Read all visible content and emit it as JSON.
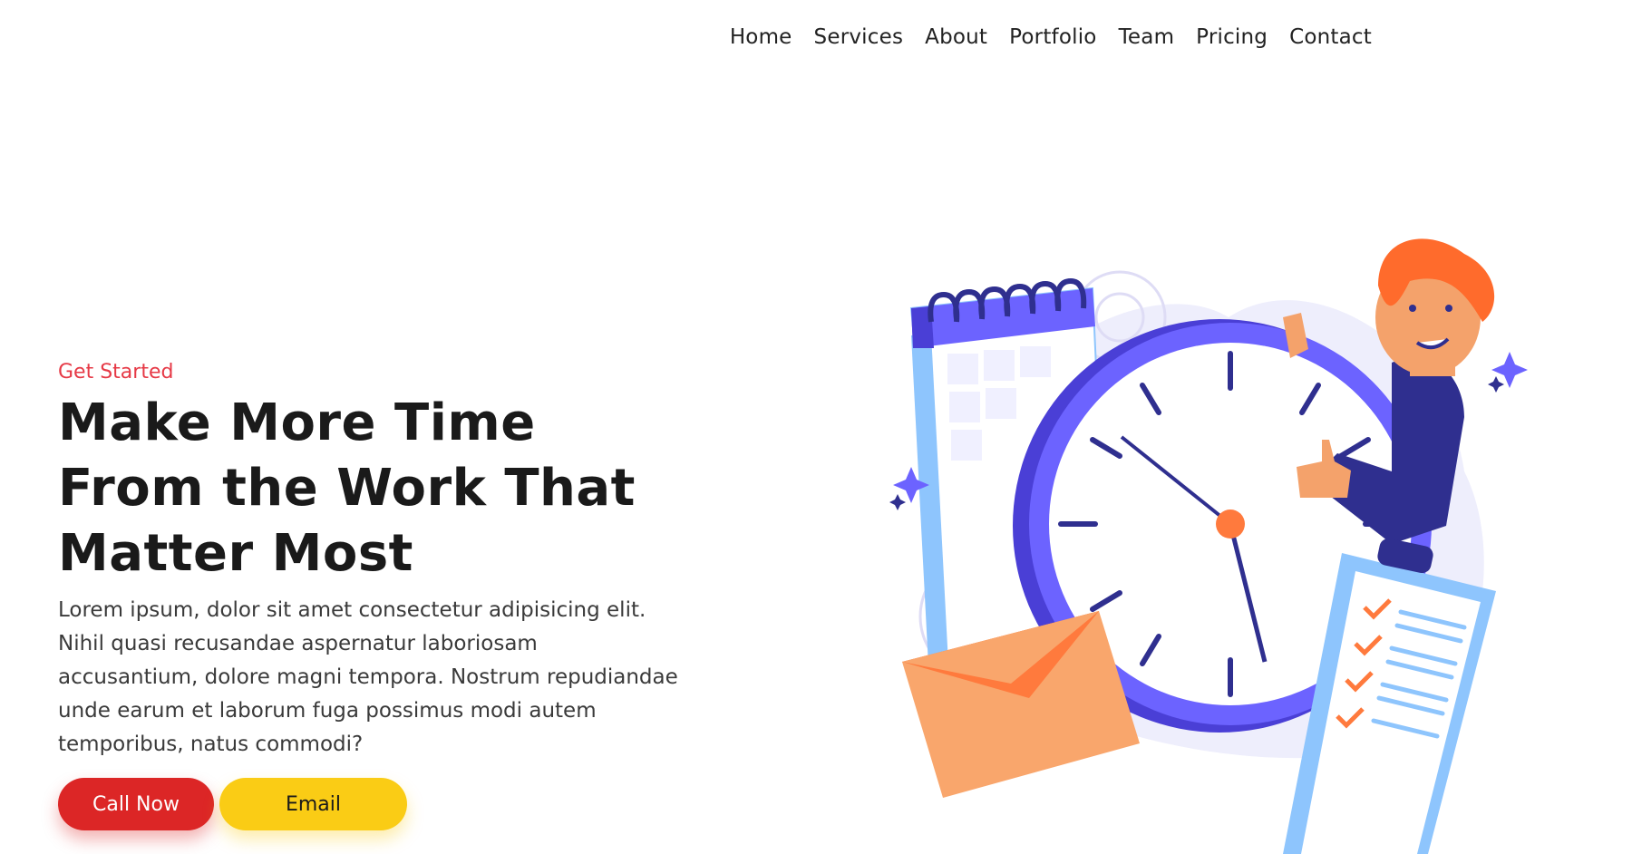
{
  "nav": {
    "items": [
      {
        "label": "Home"
      },
      {
        "label": "Services"
      },
      {
        "label": "About"
      },
      {
        "label": "Portfolio"
      },
      {
        "label": "Team"
      },
      {
        "label": "Pricing"
      },
      {
        "label": "Contact"
      }
    ]
  },
  "hero": {
    "eyebrow": "Get Started",
    "headline": "Make More Time From the Work That Matter Most",
    "lead": "Lorem ipsum, dolor sit amet consectetur adipisicing elit. Nihil quasi recusandae aspernatur laboriosam accusantium, dolore magni tempora. Nostrum repudiandae unde earum et laborum fuga possimus modi autem temporibus, natus commodi?",
    "call_label": "Call Now",
    "email_label": "Email"
  },
  "colors": {
    "accent_red": "#dc2626",
    "accent_yellow": "#facc15",
    "eyebrow": "#e63946",
    "clock_purple": "#6c63ff",
    "navy": "#2f2f8f",
    "orange": "#ff7a3d"
  },
  "illustration": {
    "icon": "time-management-illustration"
  }
}
